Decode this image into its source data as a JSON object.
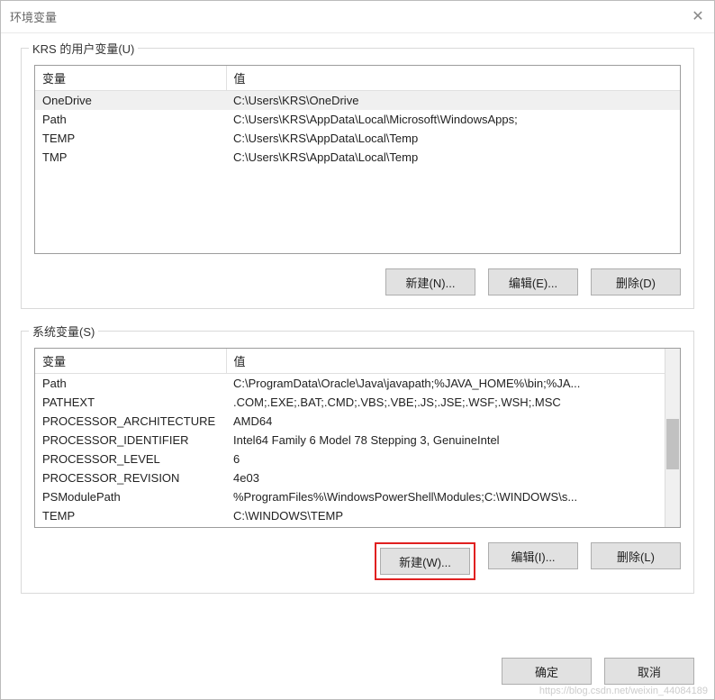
{
  "window": {
    "title": "环境变量",
    "close_tooltip": "关闭"
  },
  "user_vars": {
    "legend": "KRS 的用户变量(U)",
    "columns": {
      "name": "变量",
      "value": "值"
    },
    "rows": [
      {
        "name": "OneDrive",
        "value": "C:\\Users\\KRS\\OneDrive",
        "selected": true
      },
      {
        "name": "Path",
        "value": "C:\\Users\\KRS\\AppData\\Local\\Microsoft\\WindowsApps;"
      },
      {
        "name": "TEMP",
        "value": "C:\\Users\\KRS\\AppData\\Local\\Temp"
      },
      {
        "name": "TMP",
        "value": "C:\\Users\\KRS\\AppData\\Local\\Temp"
      }
    ],
    "buttons": {
      "new": "新建(N)...",
      "edit": "编辑(E)...",
      "delete": "删除(D)"
    }
  },
  "system_vars": {
    "legend": "系统变量(S)",
    "columns": {
      "name": "变量",
      "value": "值"
    },
    "rows": [
      {
        "name": "Path",
        "value": "C:\\ProgramData\\Oracle\\Java\\javapath;%JAVA_HOME%\\bin;%JA..."
      },
      {
        "name": "PATHEXT",
        "value": ".COM;.EXE;.BAT;.CMD;.VBS;.VBE;.JS;.JSE;.WSF;.WSH;.MSC"
      },
      {
        "name": "PROCESSOR_ARCHITECTURE",
        "value": "AMD64"
      },
      {
        "name": "PROCESSOR_IDENTIFIER",
        "value": "Intel64 Family 6 Model 78 Stepping 3, GenuineIntel"
      },
      {
        "name": "PROCESSOR_LEVEL",
        "value": "6"
      },
      {
        "name": "PROCESSOR_REVISION",
        "value": "4e03"
      },
      {
        "name": "PSModulePath",
        "value": "%ProgramFiles%\\WindowsPowerShell\\Modules;C:\\WINDOWS\\s..."
      },
      {
        "name": "TEMP",
        "value": "C:\\WINDOWS\\TEMP"
      }
    ],
    "buttons": {
      "new": "新建(W)...",
      "edit": "编辑(I)...",
      "delete": "删除(L)"
    }
  },
  "dialog_buttons": {
    "ok": "确定",
    "cancel": "取消"
  },
  "watermark": "https://blog.csdn.net/weixin_44084189"
}
